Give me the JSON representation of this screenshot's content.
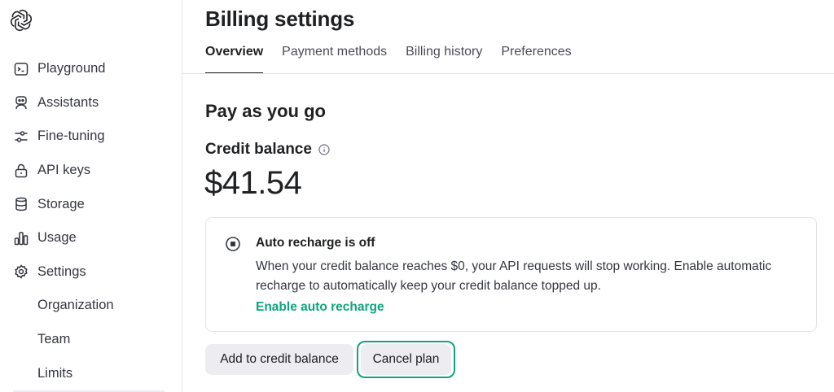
{
  "app": {
    "logo_icon": "openai-logo-icon"
  },
  "sidebar": {
    "items": [
      {
        "label": "Playground",
        "icon": "terminal-icon"
      },
      {
        "label": "Assistants",
        "icon": "robot-icon"
      },
      {
        "label": "Fine-tuning",
        "icon": "sliders-icon"
      },
      {
        "label": "API keys",
        "icon": "lock-icon"
      },
      {
        "label": "Storage",
        "icon": "database-icon"
      },
      {
        "label": "Usage",
        "icon": "bar-chart-icon"
      },
      {
        "label": "Settings",
        "icon": "gear-icon"
      }
    ],
    "subitems": [
      {
        "label": "Organization"
      },
      {
        "label": "Team"
      },
      {
        "label": "Limits"
      }
    ]
  },
  "header": {
    "title": "Billing settings",
    "tabs": [
      {
        "label": "Overview",
        "active": true
      },
      {
        "label": "Payment methods",
        "active": false
      },
      {
        "label": "Billing history",
        "active": false
      },
      {
        "label": "Preferences",
        "active": false
      }
    ]
  },
  "main": {
    "section_title": "Pay as you go",
    "credit_label": "Credit balance",
    "credit_info_icon": "info-icon",
    "balance": "$41.54",
    "notice": {
      "icon": "stop-circle-icon",
      "title": "Auto recharge is off",
      "body": "When your credit balance reaches $0, your API requests will stop working. Enable automatic recharge to automatically keep your credit balance topped up.",
      "link": "Enable auto recharge"
    },
    "buttons": {
      "add_credit": "Add to credit balance",
      "cancel_plan": "Cancel plan"
    }
  },
  "colors": {
    "accent": "#10a37f",
    "text": "#202123",
    "button_bg": "#ececf1"
  }
}
